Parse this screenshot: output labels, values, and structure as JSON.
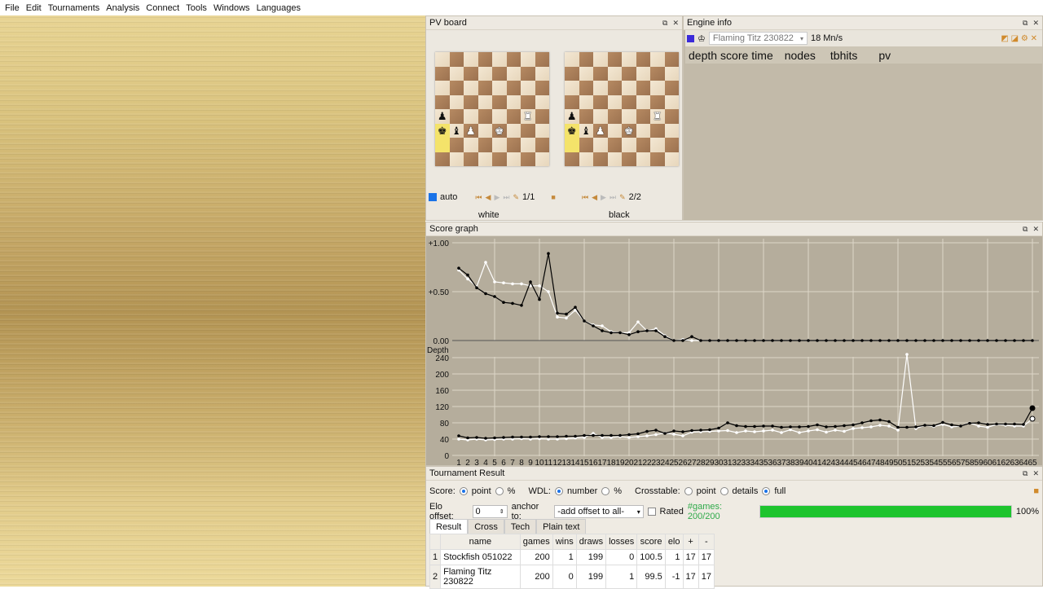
{
  "menu": [
    "File",
    "Edit",
    "Tournaments",
    "Analysis",
    "Connect",
    "Tools",
    "Windows",
    "Languages"
  ],
  "pvboard": {
    "title": "PV board",
    "auto_label": "auto",
    "white_label": "white",
    "black_label": "black",
    "white_count": "1/1",
    "black_count": "2/2",
    "position": [
      [
        "",
        "",
        "",
        "",
        "",
        "",
        "",
        ""
      ],
      [
        "",
        "",
        "",
        "",
        "",
        "",
        "",
        ""
      ],
      [
        "",
        "",
        "",
        "",
        "",
        "",
        "",
        ""
      ],
      [
        "",
        "",
        "",
        "",
        "",
        "",
        "",
        ""
      ],
      [
        "p",
        "",
        "",
        "",
        "",
        "",
        "R",
        ""
      ],
      [
        "k",
        "b",
        "P",
        "",
        "K",
        "",
        "",
        ""
      ],
      [
        "",
        "",
        "",
        "",
        "",
        "",
        "",
        ""
      ],
      [
        "",
        "",
        "",
        "",
        "",
        "",
        "",
        ""
      ]
    ]
  },
  "engine": {
    "title": "Engine info",
    "name": "Flaming Titz 230822",
    "speed": "18 Mn/s",
    "columns": [
      "depth",
      "score",
      "time",
      "nodes",
      "tbhits",
      "pv"
    ]
  },
  "score_graph": {
    "title": "Score graph",
    "depth_label": "Depth"
  },
  "chart_data": [
    {
      "type": "line",
      "title": "",
      "ylabel": "",
      "ylim": [
        0,
        1
      ],
      "y_ticks": [
        "+1.00",
        "+0.50",
        "0.00"
      ],
      "series": [
        {
          "name": "",
          "color": "#000000",
          "values": [
            0.74,
            0.67,
            0.54,
            0.48,
            0.45,
            0.39,
            0.38,
            0.36,
            0.6,
            0.42,
            0.89,
            0.28,
            0.27,
            0.34,
            0.2,
            0.15,
            0.1,
            0.08,
            0.08,
            0.06,
            0.09,
            0.1,
            0.1,
            0.04,
            0,
            0,
            0.04,
            0,
            0,
            0,
            0,
            0,
            0,
            0,
            0,
            0,
            0,
            0,
            0,
            0,
            0,
            0,
            0,
            0,
            0,
            0,
            0,
            0,
            0,
            0,
            0,
            0,
            0,
            0,
            0,
            0,
            0,
            0,
            0,
            0,
            0,
            0,
            0,
            0,
            0
          ]
        },
        {
          "name": "",
          "color": "#ffffff",
          "values": [
            0.72,
            0.63,
            0.55,
            0.8,
            0.6,
            0.59,
            0.58,
            0.58,
            0.56,
            0.56,
            0.5,
            0.24,
            0.23,
            0.31,
            0.2,
            0.16,
            0.15,
            0.09,
            0.08,
            0.08,
            0.19,
            0.1,
            0.12,
            0.05,
            0,
            0.01,
            0,
            0,
            0,
            0,
            0,
            0,
            0,
            0,
            0,
            0,
            0,
            0,
            0,
            0,
            0,
            0,
            0,
            0,
            0,
            0,
            0,
            0,
            0,
            0,
            0,
            0,
            0,
            0,
            0,
            0,
            0,
            0,
            0,
            0,
            0,
            0,
            0,
            0,
            0
          ]
        }
      ]
    },
    {
      "type": "line",
      "title": "",
      "ylabel": "Depth",
      "ylim": [
        0,
        250
      ],
      "y_ticks": [
        "240",
        "200",
        "160",
        "120",
        "80",
        "40",
        "0"
      ],
      "categories": [
        "1",
        "2",
        "3",
        "4",
        "5",
        "6",
        "7",
        "8",
        "9",
        "10",
        "11",
        "12",
        "13",
        "14",
        "15",
        "16",
        "17",
        "18",
        "19",
        "20",
        "21",
        "22",
        "23",
        "24",
        "25",
        "26",
        "27",
        "28",
        "29",
        "30",
        "31",
        "32",
        "33",
        "34",
        "35",
        "36",
        "37",
        "38",
        "39",
        "40",
        "41",
        "42",
        "43",
        "44",
        "45",
        "46",
        "47",
        "48",
        "49",
        "50",
        "51",
        "52",
        "53",
        "54",
        "55",
        "56",
        "57",
        "58",
        "59",
        "60",
        "61",
        "62",
        "63",
        "64",
        "65"
      ],
      "series": [
        {
          "name": "",
          "color": "#000000",
          "values": [
            48,
            43,
            44,
            42,
            43,
            44,
            45,
            45,
            45,
            46,
            46,
            46,
            47,
            47,
            49,
            49,
            49,
            49,
            49,
            51,
            53,
            59,
            62,
            54,
            60,
            58,
            61,
            62,
            63,
            67,
            80,
            73,
            71,
            71,
            72,
            72,
            69,
            70,
            70,
            71,
            75,
            70,
            71,
            73,
            75,
            80,
            85,
            87,
            83,
            69,
            69,
            70,
            74,
            73,
            81,
            75,
            72,
            79,
            80,
            76,
            77,
            77,
            77,
            76,
            116
          ]
        },
        {
          "name": "",
          "color": "#ffffff",
          "values": [
            40,
            38,
            40,
            38,
            39,
            40,
            40,
            41,
            40,
            41,
            40,
            40,
            41,
            43,
            44,
            54,
            44,
            44,
            46,
            44,
            46,
            48,
            51,
            55,
            52,
            48,
            57,
            58,
            59,
            60,
            61,
            56,
            60,
            58,
            60,
            62,
            56,
            63,
            56,
            60,
            63,
            57,
            62,
            59,
            66,
            68,
            70,
            74,
            72,
            62,
            253,
            66,
            74,
            71,
            76,
            70,
            72,
            80,
            72,
            69,
            76,
            74,
            72,
            72,
            90
          ]
        }
      ]
    }
  ],
  "result": {
    "title": "Tournament Result",
    "score_label": "Score:",
    "point_label": "point",
    "pct_label": "%",
    "wdl_label": "WDL:",
    "number_label": "number",
    "pct2_label": "%",
    "cross_label": "Crosstable:",
    "cpoint_label": "point",
    "details_label": "details",
    "full_label": "full",
    "elo_offset_label": "Elo offset:",
    "elo_offset_value": "0",
    "anchor_label": "anchor to:",
    "anchor_value": "-add offset to all-",
    "rated_label": "Rated",
    "games_label": "#games: 200/200",
    "progress": 1.0,
    "progress_text": "100%",
    "tabs": [
      "Result",
      "Cross",
      "Tech",
      "Plain text"
    ],
    "columns": [
      "name",
      "games",
      "wins",
      "draws",
      "losses",
      "score",
      "elo",
      "+",
      "-"
    ],
    "rows": [
      [
        "1",
        "Stockfish 051022",
        "200",
        "1",
        "199",
        "0",
        "100.5",
        "1",
        "17",
        "17"
      ],
      [
        "2",
        "Flaming Titz 230822",
        "200",
        "0",
        "199",
        "1",
        "99.5",
        "-1",
        "17",
        "17"
      ]
    ]
  }
}
